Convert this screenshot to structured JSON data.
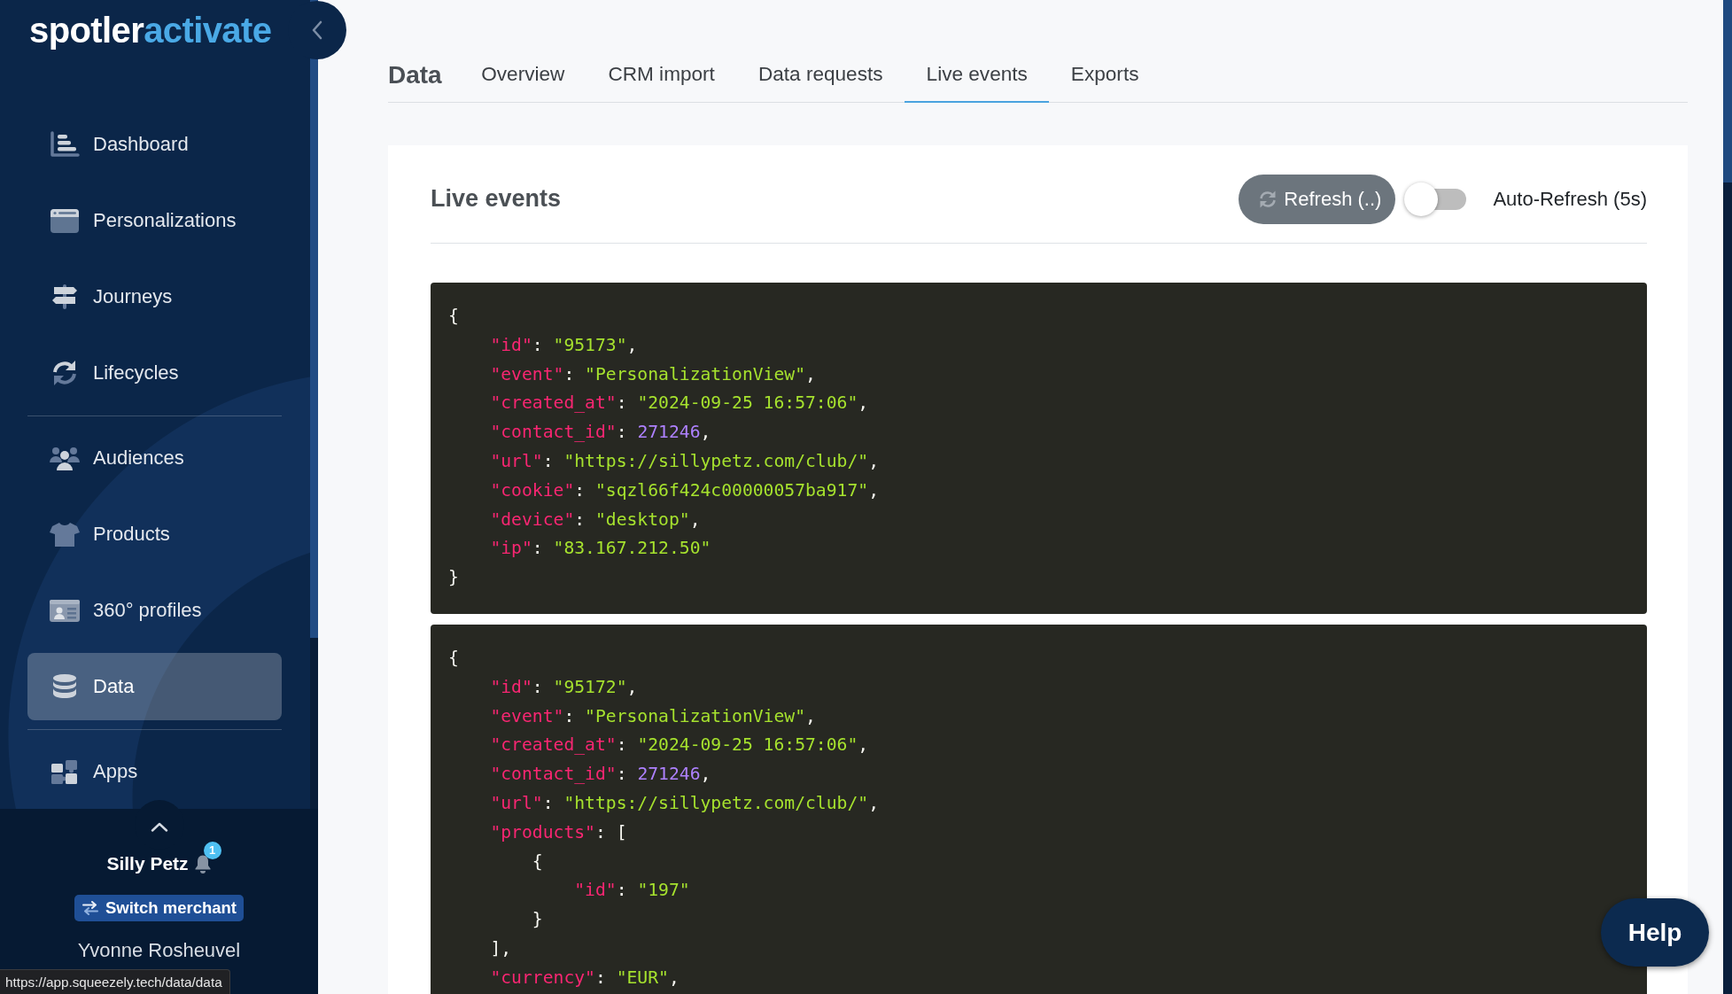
{
  "sidebar": {
    "logo": {
      "text": "spotler",
      "accent": "activate"
    },
    "groups": [
      {
        "items": [
          {
            "label": "Dashboard",
            "selected": false
          },
          {
            "label": "Personalizations",
            "selected": false
          },
          {
            "label": "Journeys",
            "selected": false
          },
          {
            "label": "Lifecycles",
            "selected": false
          }
        ]
      },
      {
        "items": [
          {
            "label": "Audiences",
            "selected": false
          },
          {
            "label": "Products",
            "selected": false
          },
          {
            "label": "360° profiles",
            "selected": false
          },
          {
            "label": "Data",
            "selected": true
          }
        ]
      },
      {
        "items": [
          {
            "label": "Apps",
            "selected": false
          }
        ]
      }
    ],
    "account": {
      "merchant": "Silly Petz",
      "notifications": "1",
      "switch_button": "Switch merchant",
      "user": "Yvonne Rosheuvel"
    }
  },
  "header": {
    "title": "Data",
    "tabs": [
      {
        "label": "Overview",
        "selected": false
      },
      {
        "label": "CRM import",
        "selected": false
      },
      {
        "label": "Data requests",
        "selected": false
      },
      {
        "label": "Live events",
        "selected": true
      },
      {
        "label": "Exports",
        "selected": false
      }
    ]
  },
  "live_events": {
    "title": "Live events",
    "refresh_button": "Refresh (..)",
    "auto_refresh": {
      "label": "Auto-Refresh (5s)",
      "on": false
    },
    "events": [
      {
        "lines": [
          {
            "tokens": [
              {
                "kind": "punct",
                "text": "{"
              }
            ],
            "children": [
              {
                "tokens": [
                  {
                    "kind": "key",
                    "text": "\"id\""
                  },
                  {
                    "kind": "punct",
                    "text": ": "
                  },
                  {
                    "kind": "string",
                    "text": "\"95173\""
                  },
                  {
                    "kind": "punct",
                    "text": ","
                  }
                ]
              },
              {
                "tokens": [
                  {
                    "kind": "key",
                    "text": "\"event\""
                  },
                  {
                    "kind": "punct",
                    "text": ": "
                  },
                  {
                    "kind": "string",
                    "text": "\"PersonalizationView\""
                  },
                  {
                    "kind": "punct",
                    "text": ","
                  }
                ]
              },
              {
                "tokens": [
                  {
                    "kind": "key",
                    "text": "\"created_at\""
                  },
                  {
                    "kind": "punct",
                    "text": ": "
                  },
                  {
                    "kind": "string",
                    "text": "\"2024-09-25 16:57:06\""
                  },
                  {
                    "kind": "punct",
                    "text": ","
                  }
                ]
              },
              {
                "tokens": [
                  {
                    "kind": "key",
                    "text": "\"contact_id\""
                  },
                  {
                    "kind": "punct",
                    "text": ": "
                  },
                  {
                    "kind": "number",
                    "text": "271246"
                  },
                  {
                    "kind": "punct",
                    "text": ","
                  }
                ]
              },
              {
                "tokens": [
                  {
                    "kind": "key",
                    "text": "\"url\""
                  },
                  {
                    "kind": "punct",
                    "text": ": "
                  },
                  {
                    "kind": "string",
                    "text": "\"https://sillypetz.com/club/\""
                  },
                  {
                    "kind": "punct",
                    "text": ","
                  }
                ]
              },
              {
                "tokens": [
                  {
                    "kind": "key",
                    "text": "\"cookie\""
                  },
                  {
                    "kind": "punct",
                    "text": ": "
                  },
                  {
                    "kind": "string",
                    "text": "\"sqzl66f424c00000057ba917\""
                  },
                  {
                    "kind": "punct",
                    "text": ","
                  }
                ]
              },
              {
                "tokens": [
                  {
                    "kind": "key",
                    "text": "\"device\""
                  },
                  {
                    "kind": "punct",
                    "text": ": "
                  },
                  {
                    "kind": "string",
                    "text": "\"desktop\""
                  },
                  {
                    "kind": "punct",
                    "text": ","
                  }
                ]
              },
              {
                "tokens": [
                  {
                    "kind": "key",
                    "text": "\"ip\""
                  },
                  {
                    "kind": "punct",
                    "text": ": "
                  },
                  {
                    "kind": "string",
                    "text": "\"83.167.212.50\""
                  }
                ]
              }
            ]
          },
          {
            "tokens": [
              {
                "kind": "punct",
                "text": "}"
              }
            ]
          }
        ]
      },
      {
        "lines": [
          {
            "tokens": [
              {
                "kind": "punct",
                "text": "{"
              }
            ],
            "children": [
              {
                "tokens": [
                  {
                    "kind": "key",
                    "text": "\"id\""
                  },
                  {
                    "kind": "punct",
                    "text": ": "
                  },
                  {
                    "kind": "string",
                    "text": "\"95172\""
                  },
                  {
                    "kind": "punct",
                    "text": ","
                  }
                ]
              },
              {
                "tokens": [
                  {
                    "kind": "key",
                    "text": "\"event\""
                  },
                  {
                    "kind": "punct",
                    "text": ": "
                  },
                  {
                    "kind": "string",
                    "text": "\"PersonalizationView\""
                  },
                  {
                    "kind": "punct",
                    "text": ","
                  }
                ]
              },
              {
                "tokens": [
                  {
                    "kind": "key",
                    "text": "\"created_at\""
                  },
                  {
                    "kind": "punct",
                    "text": ": "
                  },
                  {
                    "kind": "string",
                    "text": "\"2024-09-25 16:57:06\""
                  },
                  {
                    "kind": "punct",
                    "text": ","
                  }
                ]
              },
              {
                "tokens": [
                  {
                    "kind": "key",
                    "text": "\"contact_id\""
                  },
                  {
                    "kind": "punct",
                    "text": ": "
                  },
                  {
                    "kind": "number",
                    "text": "271246"
                  },
                  {
                    "kind": "punct",
                    "text": ","
                  }
                ]
              },
              {
                "tokens": [
                  {
                    "kind": "key",
                    "text": "\"url\""
                  },
                  {
                    "kind": "punct",
                    "text": ": "
                  },
                  {
                    "kind": "string",
                    "text": "\"https://sillypetz.com/club/\""
                  },
                  {
                    "kind": "punct",
                    "text": ","
                  }
                ]
              },
              {
                "tokens": [
                  {
                    "kind": "key",
                    "text": "\"products\""
                  },
                  {
                    "kind": "punct",
                    "text": ": ["
                  }
                ],
                "children": [
                  {
                    "tokens": [
                      {
                        "kind": "punct",
                        "text": "{"
                      }
                    ],
                    "children": [
                      {
                        "tokens": [
                          {
                            "kind": "key",
                            "text": "\"id\""
                          },
                          {
                            "kind": "punct",
                            "text": ": "
                          },
                          {
                            "kind": "string",
                            "text": "\"197\""
                          }
                        ]
                      }
                    ]
                  },
                  {
                    "tokens": [
                      {
                        "kind": "punct",
                        "text": "}"
                      }
                    ]
                  }
                ]
              },
              {
                "tokens": [
                  {
                    "kind": "punct",
                    "text": "],"
                  }
                ]
              },
              {
                "tokens": [
                  {
                    "kind": "key",
                    "text": "\"currency\""
                  },
                  {
                    "kind": "punct",
                    "text": ": "
                  },
                  {
                    "kind": "string",
                    "text": "\"EUR\""
                  },
                  {
                    "kind": "punct",
                    "text": ","
                  }
                ]
              }
            ]
          }
        ]
      }
    ]
  },
  "help_button": "Help",
  "status_bar": {
    "url": "https://app.squeezely.tech/data/data"
  }
}
